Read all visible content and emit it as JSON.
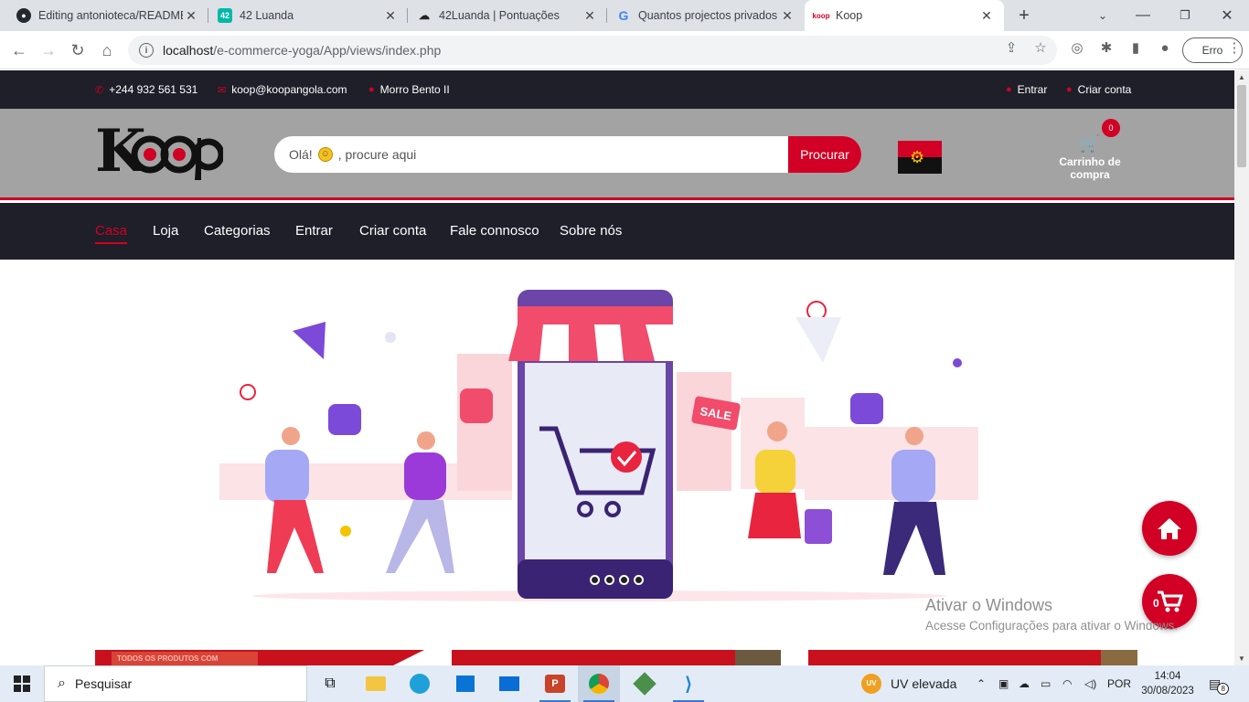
{
  "browser": {
    "tabs": [
      {
        "title": "Editing antonioteca/README.md",
        "favicon": "github-icon",
        "active": false
      },
      {
        "title": "42 Luanda",
        "favicon": "42-icon",
        "active": false
      },
      {
        "title": "42Luanda | Pontuações",
        "favicon": "42-icon",
        "active": false
      },
      {
        "title": "Quantos projectos privados",
        "favicon": "google-icon",
        "active": false
      },
      {
        "title": "Koop",
        "favicon": "koop-icon",
        "active": true
      }
    ],
    "url_host": "localhost",
    "url_path": "/e-commerce-yoga/App/views/index.php",
    "error_button": "Erro"
  },
  "site": {
    "topbar": {
      "phone": "+244 932 561 531",
      "email": "koop@koopangola.com",
      "location": "Morro Bento II",
      "login": "Entrar",
      "signup": "Criar conta"
    },
    "logo": "Koop",
    "search": {
      "placeholder_prefix": "Olá!",
      "placeholder_suffix": ", procure aqui",
      "button": "Procurar"
    },
    "cart": {
      "label": "Carrinho de compra",
      "count": "0"
    },
    "nav": [
      "Casa",
      "Loja",
      "Categorias",
      "Entrar",
      "Criar conta",
      "Fale connosco",
      "Sobre nós"
    ],
    "hero": {
      "sale_tag": "SALE",
      "slide_count": 4
    },
    "floating_cart_count": "0",
    "card_text": "TODOS OS PRODUTOS COM"
  },
  "watermark": {
    "title": "Ativar o Windows",
    "subtitle": "Acesse Configurações para ativar o Windows."
  },
  "taskbar": {
    "search": "Pesquisar",
    "weather": "UV elevada",
    "weather_badge": "UV",
    "language": "POR",
    "time": "14:04",
    "date": "30/08/2023",
    "notifications": "8"
  },
  "colors": {
    "accent": "#d10024",
    "dark": "#1e1f29",
    "header_bg": "#a3a3a3"
  }
}
